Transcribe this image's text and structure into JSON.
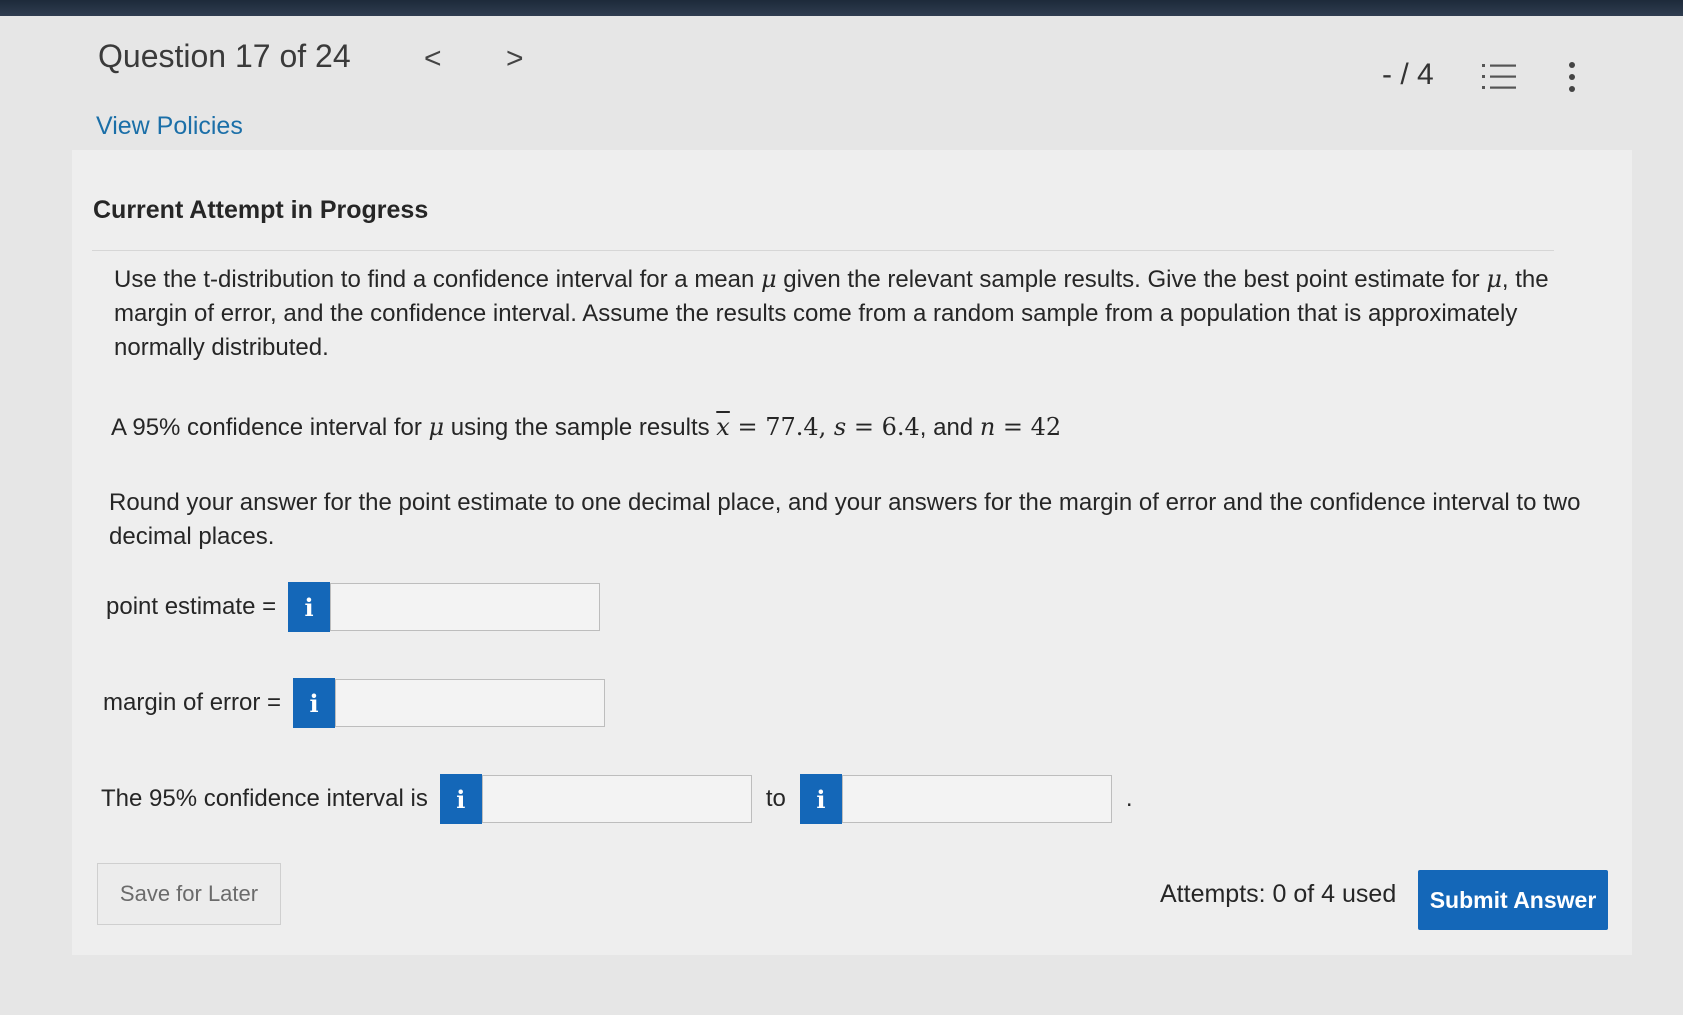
{
  "header": {
    "question_title": "Question 17 of 24",
    "prev_label": "<",
    "next_label": ">",
    "score": "- / 4",
    "list_icon": "list-icon",
    "more_icon": "more-vertical-icon"
  },
  "policies_link": "View Policies",
  "attempt_heading": "Current Attempt in Progress",
  "question": {
    "intro_1": "Use the t-distribution to find a confidence interval for a mean ",
    "intro_mu_1": "μ",
    "intro_2": " given the relevant sample results. Give the best point estimate for ",
    "intro_mu_2": "μ",
    "intro_3": ", the margin of error, and the confidence interval. Assume the results come from a random sample from a population that is approximately normally distributed.",
    "given_1": "A 95% confidence interval for ",
    "given_mu": "μ",
    "given_2": " using the sample results ",
    "xbar_symbol": "x",
    "xbar_value": " = 77.4, ",
    "s_symbol": "s",
    "s_value": " = 6.4",
    "and_text": ", and ",
    "n_symbol": "n",
    "n_value": " = 42",
    "rounding": "Round your answer for the point estimate to one decimal place, and your answers for the margin of error and the confidence interval to two decimal places."
  },
  "answers": {
    "point_estimate_label": "point estimate =",
    "point_estimate_value": "",
    "margin_label": "margin of error =",
    "margin_value": "",
    "interval_label": "The 95% confidence interval is",
    "interval_low_value": "",
    "to_label": "to",
    "interval_high_value": "",
    "period": ".",
    "info_glyph": "i"
  },
  "footer": {
    "save_label": "Save for Later",
    "attempts_text": "Attempts: 0 of 4 used",
    "submit_label": "Submit Answer"
  },
  "colors": {
    "accent": "#1467b8",
    "link": "#1b6fa8"
  }
}
